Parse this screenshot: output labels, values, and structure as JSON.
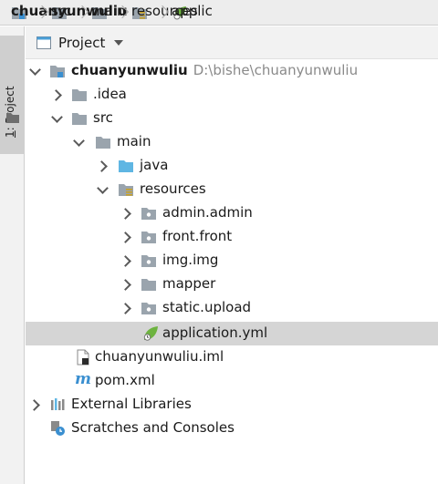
{
  "breadcrumb": [
    {
      "label": "chuanyunwuliu",
      "icon": "module-folder-icon",
      "bold": true
    },
    {
      "label": "src",
      "icon": "folder-icon"
    },
    {
      "label": "main",
      "icon": "folder-icon"
    },
    {
      "label": "resources",
      "icon": "resources-folder-icon"
    },
    {
      "label": "applic",
      "icon": "spring-leaf-icon"
    }
  ],
  "tool_window": {
    "stripe_label_number": "1",
    "stripe_label_text": ": Project",
    "panel_title": "Project"
  },
  "tree": {
    "root": {
      "label": "chuanyunwuliu",
      "path": "D:\\bishe\\chuanyunwuliu"
    },
    "idea": "idea_label_placeholder",
    "items": {
      "idea": ".idea",
      "src": "src",
      "main": "main",
      "java": "java",
      "resources": "resources",
      "admin": "admin.admin",
      "front": "front.front",
      "img": "img.img",
      "mapper": "mapper",
      "static_upload": "static.upload",
      "application_yml": "application.yml",
      "iml": "chuanyunwuliu.iml",
      "pom": "pom.xml",
      "external_libraries": "External Libraries",
      "scratches": "Scratches and Consoles"
    }
  },
  "colors": {
    "folder": "#9aa4ad",
    "java_folder": "#5fb6e3",
    "spring": "#6db33f",
    "selection": "#d5d5d5"
  }
}
